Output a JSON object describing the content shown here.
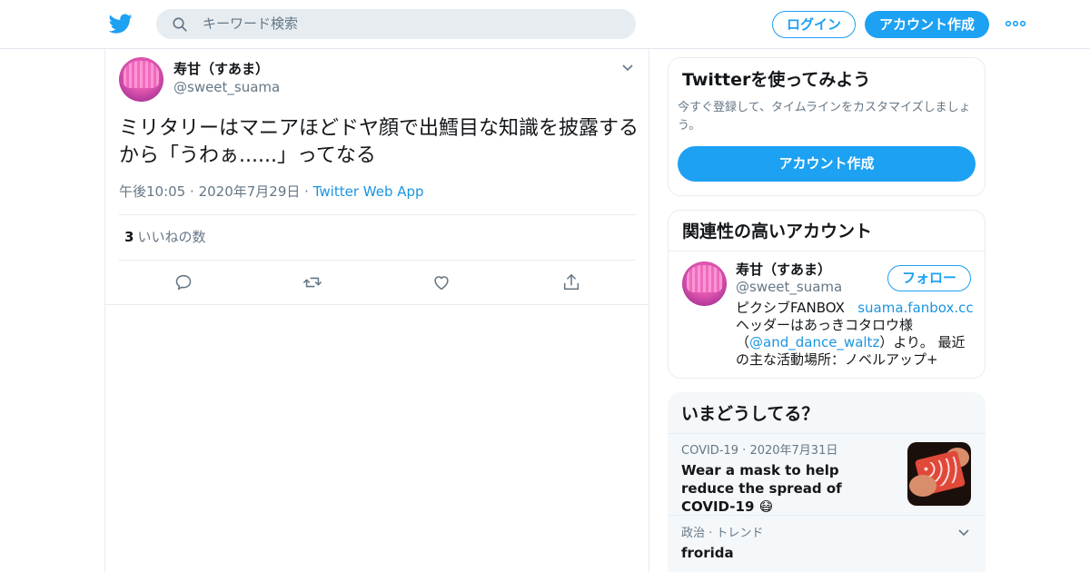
{
  "header": {
    "search_placeholder": "キーワード検索",
    "login_label": "ログイン",
    "signup_label": "アカウント作成"
  },
  "tweet": {
    "display_name": "寿甘（すあま）",
    "handle": "@sweet_suama",
    "text": "ミリタリーはマニアほどドヤ顔で出鱈目な知識を披露するから「うわぁ......」ってなる",
    "time": "午後10:05",
    "date": "2020年7月29日",
    "source": "Twitter Web App",
    "likes_count": "3",
    "likes_label": "いいねの数",
    "separator": "·"
  },
  "signup_card": {
    "title": "Twitterを使ってみよう",
    "description": "今すぐ登録して、タイムラインをカスタマイズしましょう。",
    "button_label": "アカウント作成"
  },
  "related": {
    "title": "関連性の高いアカウント",
    "display_name": "寿甘（すあま）",
    "handle": "@sweet_suama",
    "follow_label": "フォロー",
    "bio_part1": "ピクシブFANBOX",
    "bio_link1": "suama.fanbox.cc",
    "bio_part2": "ヘッダーはあっきコタロウ様（",
    "bio_link2": "@and_dance_waltz",
    "bio_part3": "）より。 最近の主な活動場所：ノベルアップ+"
  },
  "trends": {
    "title": "いまどうしてる？",
    "item1_meta": "COVID-19 · 2020年7月31日",
    "item1_title": "Wear a mask to help reduce the spread of COVID-19 😷",
    "item2_meta": "政治 · トレンド",
    "item2_title": "frorida"
  },
  "colors": {
    "accent": "#1da1f2",
    "link": "#1b95e0",
    "muted": "#657786"
  }
}
